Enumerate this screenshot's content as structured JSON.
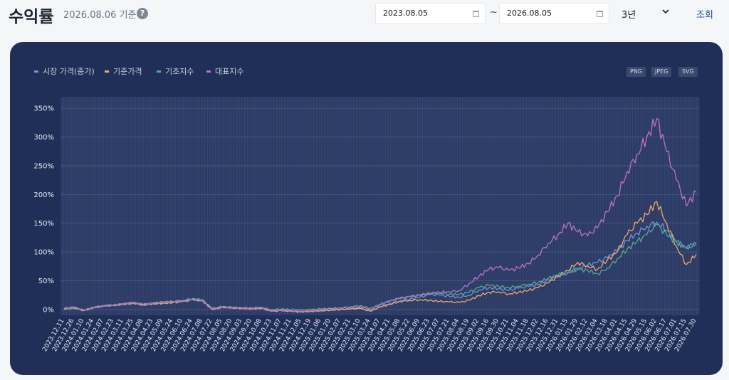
{
  "header": {
    "title": "수익률",
    "subtitle": "2026.08.06 기준",
    "help_glyph": "?",
    "start_date": "2023.08.05",
    "separator": "~",
    "end_date": "2026.08.05",
    "period": "3년",
    "query_label": "조회"
  },
  "export_buttons": [
    "PNG",
    "JPEG",
    "SVG"
  ],
  "colors": {
    "card": "#1f2f58",
    "plot_bg": "#2c3c66",
    "market": "#6f93d6",
    "nav": "#f4a66a",
    "base": "#58a88f",
    "index": "#c070c8"
  },
  "chart_data": {
    "type": "line",
    "title": "",
    "xlabel": "",
    "ylabel": "",
    "ylim": [
      -10,
      370
    ],
    "y_ticks": [
      0,
      50,
      100,
      150,
      200,
      250,
      300,
      350
    ],
    "y_unit": "%",
    "grid": true,
    "legend_position": "top-left",
    "x": [
      "2023.12.11",
      "2023.12.26",
      "2024.01.10",
      "2024.01.24",
      "2024.02.07",
      "2024.02.23",
      "2024.03.11",
      "2024.03.25",
      "2024.04.08",
      "2024.04.23",
      "2024.05.09",
      "2024.05.24",
      "2024.06.10",
      "2024.06.24",
      "2024.07.08",
      "2024.07.22",
      "2024.08.05",
      "2024.08.20",
      "2024.09.03",
      "2024.09.20",
      "2024.10.08",
      "2024.10.23",
      "2024.11.07",
      "2024.11.21",
      "2024.12.05",
      "2024.12.19",
      "2025.01.06",
      "2025.01.20",
      "2025.02.07",
      "2025.02.21",
      "2025.03.10",
      "2025.03.24",
      "2025.04.07",
      "2025.04.21",
      "2025.05.08",
      "2025.05.22",
      "2025.06.09",
      "2025.06.23",
      "2025.07.07",
      "2025.07.21",
      "2025.08.04",
      "2025.08.19",
      "2025.09.02",
      "2025.09.16",
      "2025.09.30",
      "2025.10.21",
      "2025.11.04",
      "2025.11.18",
      "2025.12.02",
      "2025.12.16",
      "2025.12.31",
      "2026.01.15",
      "2026.01.29",
      "2026.02.12",
      "2026.03.04",
      "2026.03.18",
      "2026.04.01",
      "2026.04.15",
      "2026.04.29",
      "2026.05.15",
      "2026.06.02",
      "2026.06.17",
      "2026.07.01",
      "2026.07.15",
      "2026.07.30"
    ],
    "series": [
      {
        "name": "시장 가격(종가)",
        "color": "#6f93d6",
        "values": [
          1,
          4,
          -2,
          3,
          6,
          7,
          9,
          11,
          8,
          10,
          11,
          12,
          14,
          17,
          15,
          0,
          4,
          3,
          2,
          1,
          2,
          -3,
          -2,
          -3,
          -4,
          -3,
          -2,
          -1,
          0,
          1,
          2,
          -3,
          5,
          11,
          15,
          18,
          21,
          26,
          25,
          23,
          21,
          25,
          34,
          38,
          36,
          33,
          37,
          40,
          43,
          52,
          58,
          64,
          71,
          77,
          82,
          90,
          102,
          120,
          133,
          145,
          152,
          138,
          118,
          106,
          114
        ]
      },
      {
        "name": "기준가격",
        "color": "#f4a66a",
        "values": [
          1,
          3,
          -2,
          3,
          6,
          7,
          9,
          11,
          8,
          10,
          11,
          12,
          14,
          17,
          15,
          0,
          4,
          3,
          2,
          1,
          2,
          -3,
          -2,
          -3,
          -4,
          -3,
          -2,
          -1,
          0,
          1,
          2,
          -3,
          4,
          9,
          14,
          16,
          17,
          16,
          14,
          13,
          12,
          16,
          24,
          30,
          31,
          27,
          30,
          33,
          38,
          46,
          58,
          68,
          82,
          76,
          70,
          86,
          100,
          130,
          150,
          165,
          188,
          150,
          110,
          78,
          96
        ]
      },
      {
        "name": "기초지수",
        "color": "#58a88f",
        "values": [
          0,
          2,
          -1,
          3,
          6,
          8,
          10,
          12,
          9,
          11,
          13,
          14,
          16,
          19,
          17,
          2,
          5,
          4,
          3,
          3,
          4,
          0,
          1,
          0,
          -1,
          0,
          1,
          2,
          3,
          5,
          7,
          2,
          9,
          15,
          19,
          22,
          25,
          28,
          29,
          27,
          26,
          30,
          38,
          42,
          40,
          38,
          41,
          44,
          47,
          54,
          60,
          64,
          70,
          68,
          62,
          72,
          88,
          105,
          118,
          130,
          148,
          130,
          117,
          108,
          116
        ]
      },
      {
        "name": "대표지수",
        "color": "#c070c8",
        "values": [
          2,
          4,
          -1,
          4,
          7,
          8,
          10,
          12,
          9,
          11,
          13,
          14,
          15,
          18,
          16,
          1,
          4,
          3,
          2,
          2,
          3,
          -2,
          -1,
          -2,
          -3,
          -2,
          0,
          1,
          2,
          3,
          5,
          0,
          8,
          15,
          20,
          22,
          25,
          28,
          30,
          31,
          33,
          45,
          58,
          70,
          73,
          68,
          72,
          80,
          95,
          115,
          130,
          150,
          135,
          128,
          142,
          170,
          198,
          240,
          270,
          300,
          332,
          275,
          225,
          180,
          205
        ]
      }
    ]
  }
}
